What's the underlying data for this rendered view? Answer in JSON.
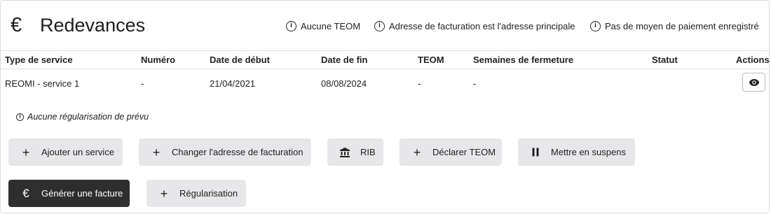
{
  "header": {
    "icon": "euro-icon",
    "title": "Redevances",
    "infos": [
      "Aucune TEOM",
      "Adresse de facturation est l'adresse principale",
      "Pas de moyen de paiement enregistré"
    ]
  },
  "table": {
    "columns": [
      "Type de service",
      "Numéro",
      "Date de début",
      "Date de fin",
      "TEOM",
      "Semaines de fermeture",
      "Statut",
      "Actions"
    ],
    "rows": [
      [
        "REOMI - service 1",
        "-",
        "21/04/2021",
        "08/08/2024",
        "-",
        "-",
        ""
      ]
    ]
  },
  "note": "Aucune régularisation de prévu",
  "buttons": [
    {
      "label": "Ajouter un service",
      "icon": "plus-icon"
    },
    {
      "label": "Changer l'adresse de facturation",
      "icon": "plus-icon"
    },
    {
      "label": "RIB",
      "icon": "bank-icon"
    },
    {
      "label": "Déclarer TEOM",
      "icon": "plus-icon"
    },
    {
      "label": "Mettre en suspens",
      "icon": "pause-icon"
    },
    {
      "label": "Générer une facture",
      "icon": "euro-icon"
    },
    {
      "label": "Régularisation",
      "icon": "plus-icon"
    }
  ],
  "colors": {
    "dark_button": "#2e2e2e",
    "light_button": "#e7e7ea",
    "border": "#dcdcdc"
  }
}
